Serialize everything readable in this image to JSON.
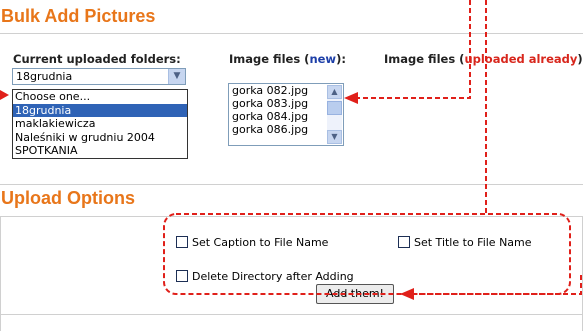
{
  "bulk_add": {
    "title": "Bulk Add Pictures",
    "folders_label": "Current uploaded folders:",
    "folder_selected": "18grudnia",
    "folder_options": [
      "Choose one...",
      "18grudnia",
      "maklakiewicza",
      "Naleśniki w grudniu 2004",
      "SPOTKANIA"
    ],
    "selected_option_index": 1,
    "image_files_label": "Image files (",
    "image_files_new": "new",
    "image_files_close": "):",
    "uploaded_label": "Image files (",
    "uploaded_word": "uploaded already",
    "uploaded_close": "):",
    "image_files": [
      "gorka 082.jpg",
      "gorka 083.jpg",
      "gorka 084.jpg",
      "gorka 086.jpg"
    ]
  },
  "upload_options": {
    "title": "Upload Options",
    "caption_label": "Set Caption to File Name",
    "title_label": "Set Title to File Name",
    "delete_label": "Delete Directory after Adding",
    "add_button": "Add them!"
  },
  "annotation_color": "#e0201a",
  "accent_color": "#e8761a"
}
